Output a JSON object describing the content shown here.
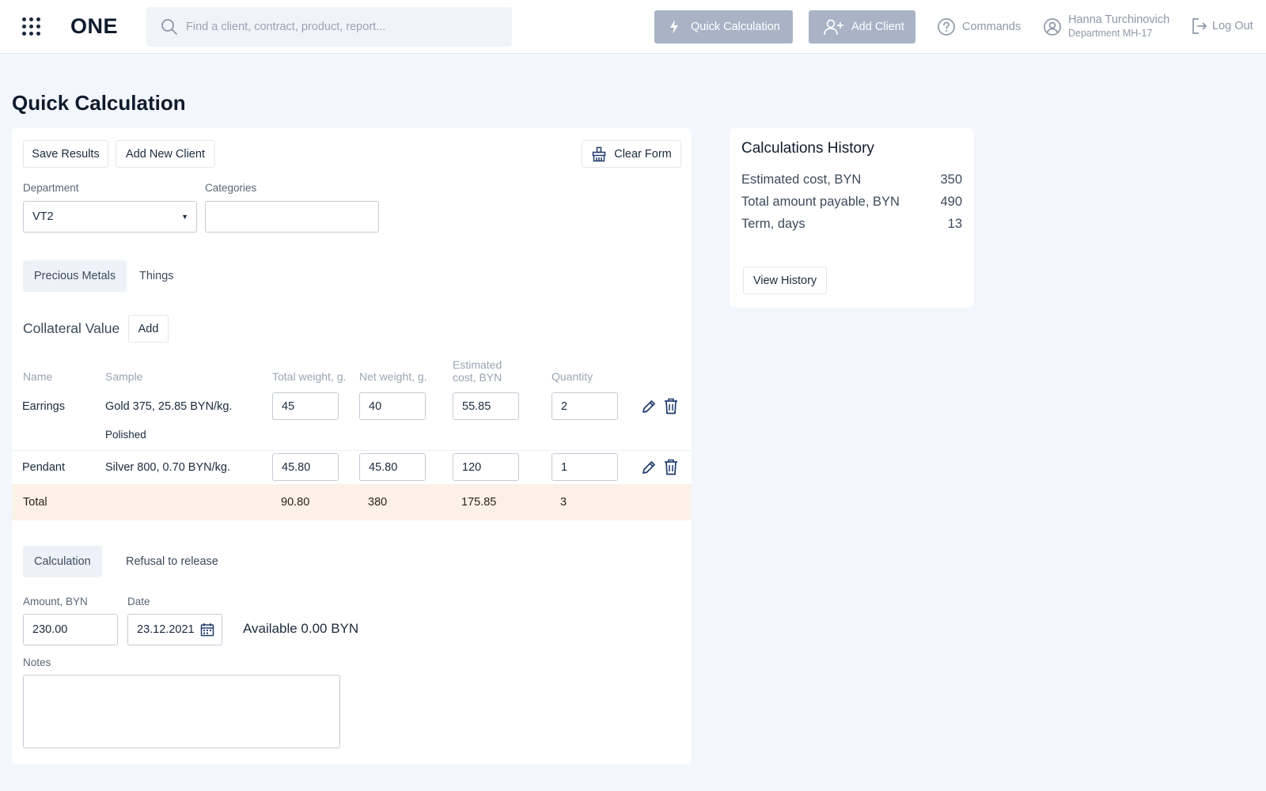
{
  "header": {
    "logo": "ONE",
    "search_placeholder": "Find a client, contract, product, report...",
    "quick_calc_label": "Quick Calculation",
    "add_client_label": "Add Client",
    "commands_label": "Commands",
    "user_name": "Hanna Turchinovich",
    "user_department": "Department MH-17",
    "logout_label": "Log Out"
  },
  "page": {
    "title": "Quick Calculation"
  },
  "toolbar": {
    "save_label": "Save Results",
    "add_new_client_label": "Add New Client",
    "clear_label": "Clear Form"
  },
  "filters": {
    "department_label": "Department",
    "department_value": "VT2",
    "categories_label": "Categories",
    "categories_value": ""
  },
  "item_tabs": [
    {
      "label": "Precious Metals",
      "active": true
    },
    {
      "label": "Things",
      "active": false
    }
  ],
  "collateral": {
    "title": "Collateral Value",
    "add_label": "Add",
    "columns": [
      "Name",
      "Sample",
      "Total weight, g.",
      "Net weight, g.",
      "Estimated cost, BYN",
      "Quantity"
    ],
    "rows": [
      {
        "name": "Earrings",
        "sample": "Gold 375, 25.85 BYN/kg.",
        "note": "Polished",
        "total_weight": "45",
        "net_weight": "40",
        "cost": "55.85",
        "quantity": "2"
      },
      {
        "name": "Pendant",
        "sample": "Silver 800, 0.70 BYN/kg.",
        "note": "",
        "total_weight": "45.80",
        "net_weight": "45.80",
        "cost": "120",
        "quantity": "1"
      }
    ],
    "total": {
      "label": "Total",
      "total_weight": "90.80",
      "net_weight": "380",
      "cost": "175.85",
      "quantity": "3"
    }
  },
  "calc_tabs": [
    {
      "label": "Calculation",
      "active": true
    },
    {
      "label": "Refusal to release",
      "active": false
    }
  ],
  "calculation": {
    "amount_label": "Amount, BYN",
    "amount_value": "230.00",
    "date_label": "Date",
    "date_value": "23.12.2021",
    "available_text": "Available 0.00 BYN",
    "notes_label": "Notes",
    "notes_value": ""
  },
  "history": {
    "title": "Calculations History",
    "rows": [
      {
        "label": "Estimated cost, BYN",
        "value": "350"
      },
      {
        "label": "Total amount payable, BYN",
        "value": "490"
      },
      {
        "label": "Term, days",
        "value": "13"
      }
    ],
    "view_label": "View History"
  },
  "icons": {
    "apps": "grid-dots-icon",
    "search": "search-icon",
    "quick_calc": "lightning-icon",
    "add_client": "add-user-icon",
    "commands": "question-circle-icon",
    "user": "user-circle-icon",
    "logout": "logout-icon",
    "clear": "broom-icon",
    "edit": "pencil-icon",
    "delete": "trash-icon",
    "calendar": "calendar-icon"
  },
  "colors": {
    "accent_button": "#a9b3c5",
    "total_row_bg": "#fbf1e8",
    "page_bg": "#f3f6fc",
    "icon_dark": "#1e3a6e"
  }
}
